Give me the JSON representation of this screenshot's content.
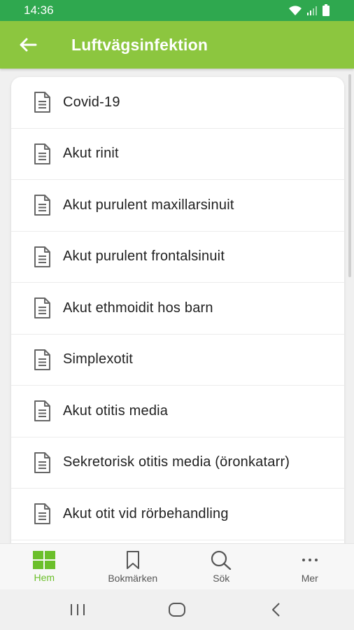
{
  "status_bar": {
    "time": "14:36"
  },
  "header": {
    "title": "Luftvägsinfektion",
    "back_icon": "arrow-left-icon"
  },
  "colors": {
    "status_bar": "#2fa84f",
    "app_bar": "#8cc63f",
    "active_tab": "#6bbf2a"
  },
  "list": {
    "items": [
      {
        "label": "Covid-19",
        "icon": "document-icon"
      },
      {
        "label": "Akut rinit",
        "icon": "document-icon"
      },
      {
        "label": "Akut purulent maxillarsinuit",
        "icon": "document-icon"
      },
      {
        "label": "Akut purulent frontalsinuit",
        "icon": "document-icon"
      },
      {
        "label": "Akut ethmoidit hos barn",
        "icon": "document-icon"
      },
      {
        "label": "Simplexotit",
        "icon": "document-icon"
      },
      {
        "label": "Akut otitis media",
        "icon": "document-icon"
      },
      {
        "label": "Sekretorisk otitis media (öronkatarr)",
        "icon": "document-icon"
      },
      {
        "label": "Akut otit vid rörbehandling",
        "icon": "document-icon"
      }
    ]
  },
  "bottom_nav": {
    "items": [
      {
        "label": "Hem",
        "icon": "grid-icon",
        "active": true
      },
      {
        "label": "Bokmärken",
        "icon": "bookmark-icon",
        "active": false
      },
      {
        "label": "Sök",
        "icon": "search-icon",
        "active": false
      },
      {
        "label": "Mer",
        "icon": "more-icon",
        "active": false
      }
    ]
  }
}
